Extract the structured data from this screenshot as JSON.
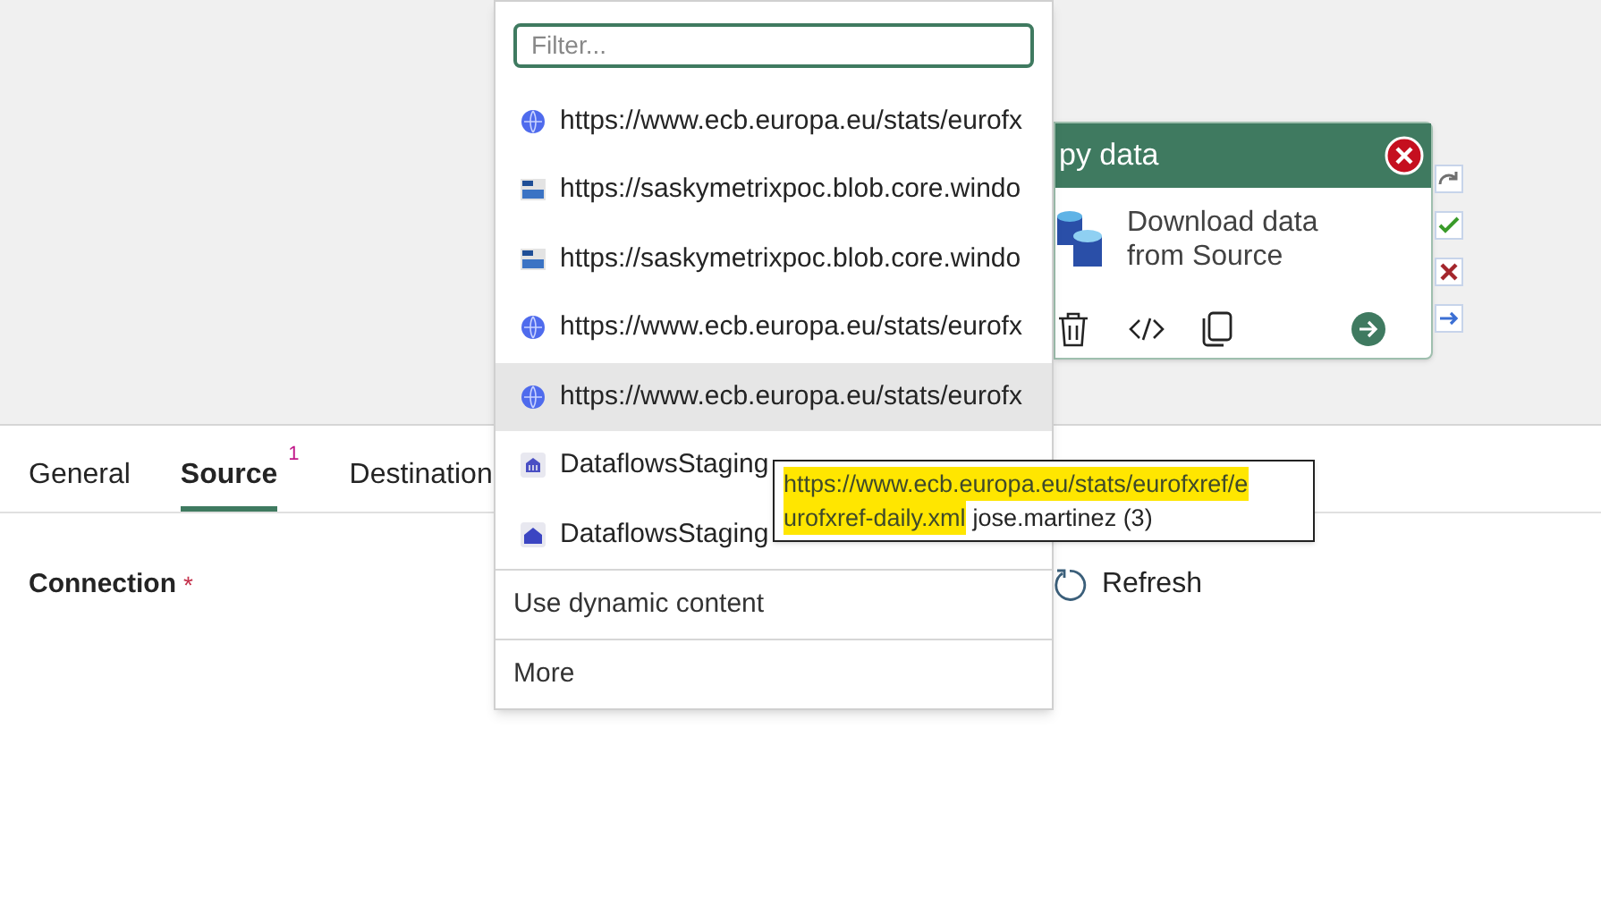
{
  "dropdown": {
    "filter": {
      "placeholder": "Filter..."
    },
    "items": [
      {
        "kind": "web",
        "label": "https://www.ecb.europa.eu/stats/eurofx",
        "selected": false
      },
      {
        "kind": "blob",
        "label": "https://saskymetrixpoc.blob.core.windo",
        "selected": false
      },
      {
        "kind": "blob",
        "label": "https://saskymetrixpoc.blob.core.windo",
        "selected": false
      },
      {
        "kind": "web",
        "label": "https://www.ecb.europa.eu/stats/eurofx",
        "selected": false
      },
      {
        "kind": "web",
        "label": "https://www.ecb.europa.eu/stats/eurofx",
        "selected": true
      },
      {
        "kind": "warehouse",
        "label": "DataflowsStaging",
        "selected": false
      },
      {
        "kind": "lakehouse",
        "label": "DataflowsStaging",
        "selected": false
      }
    ],
    "actions": [
      "Use dynamic content",
      "More"
    ]
  },
  "tooltip": {
    "url_lines": [
      "https://www.ecb.europa.eu/stats/eurofxref/e",
      "urofxref-daily.xml"
    ],
    "owner": "jose.martinez (3)"
  },
  "activity": {
    "title": "py data",
    "description": "Download data from Source"
  },
  "tabs": [
    {
      "label": "General",
      "selected": false
    },
    {
      "label": "Source",
      "selected": true,
      "badge": "1"
    },
    {
      "label": "Destination",
      "selected": false
    }
  ],
  "connection": {
    "label": "Connection",
    "required_marker": "*",
    "refresh": "Refresh"
  }
}
